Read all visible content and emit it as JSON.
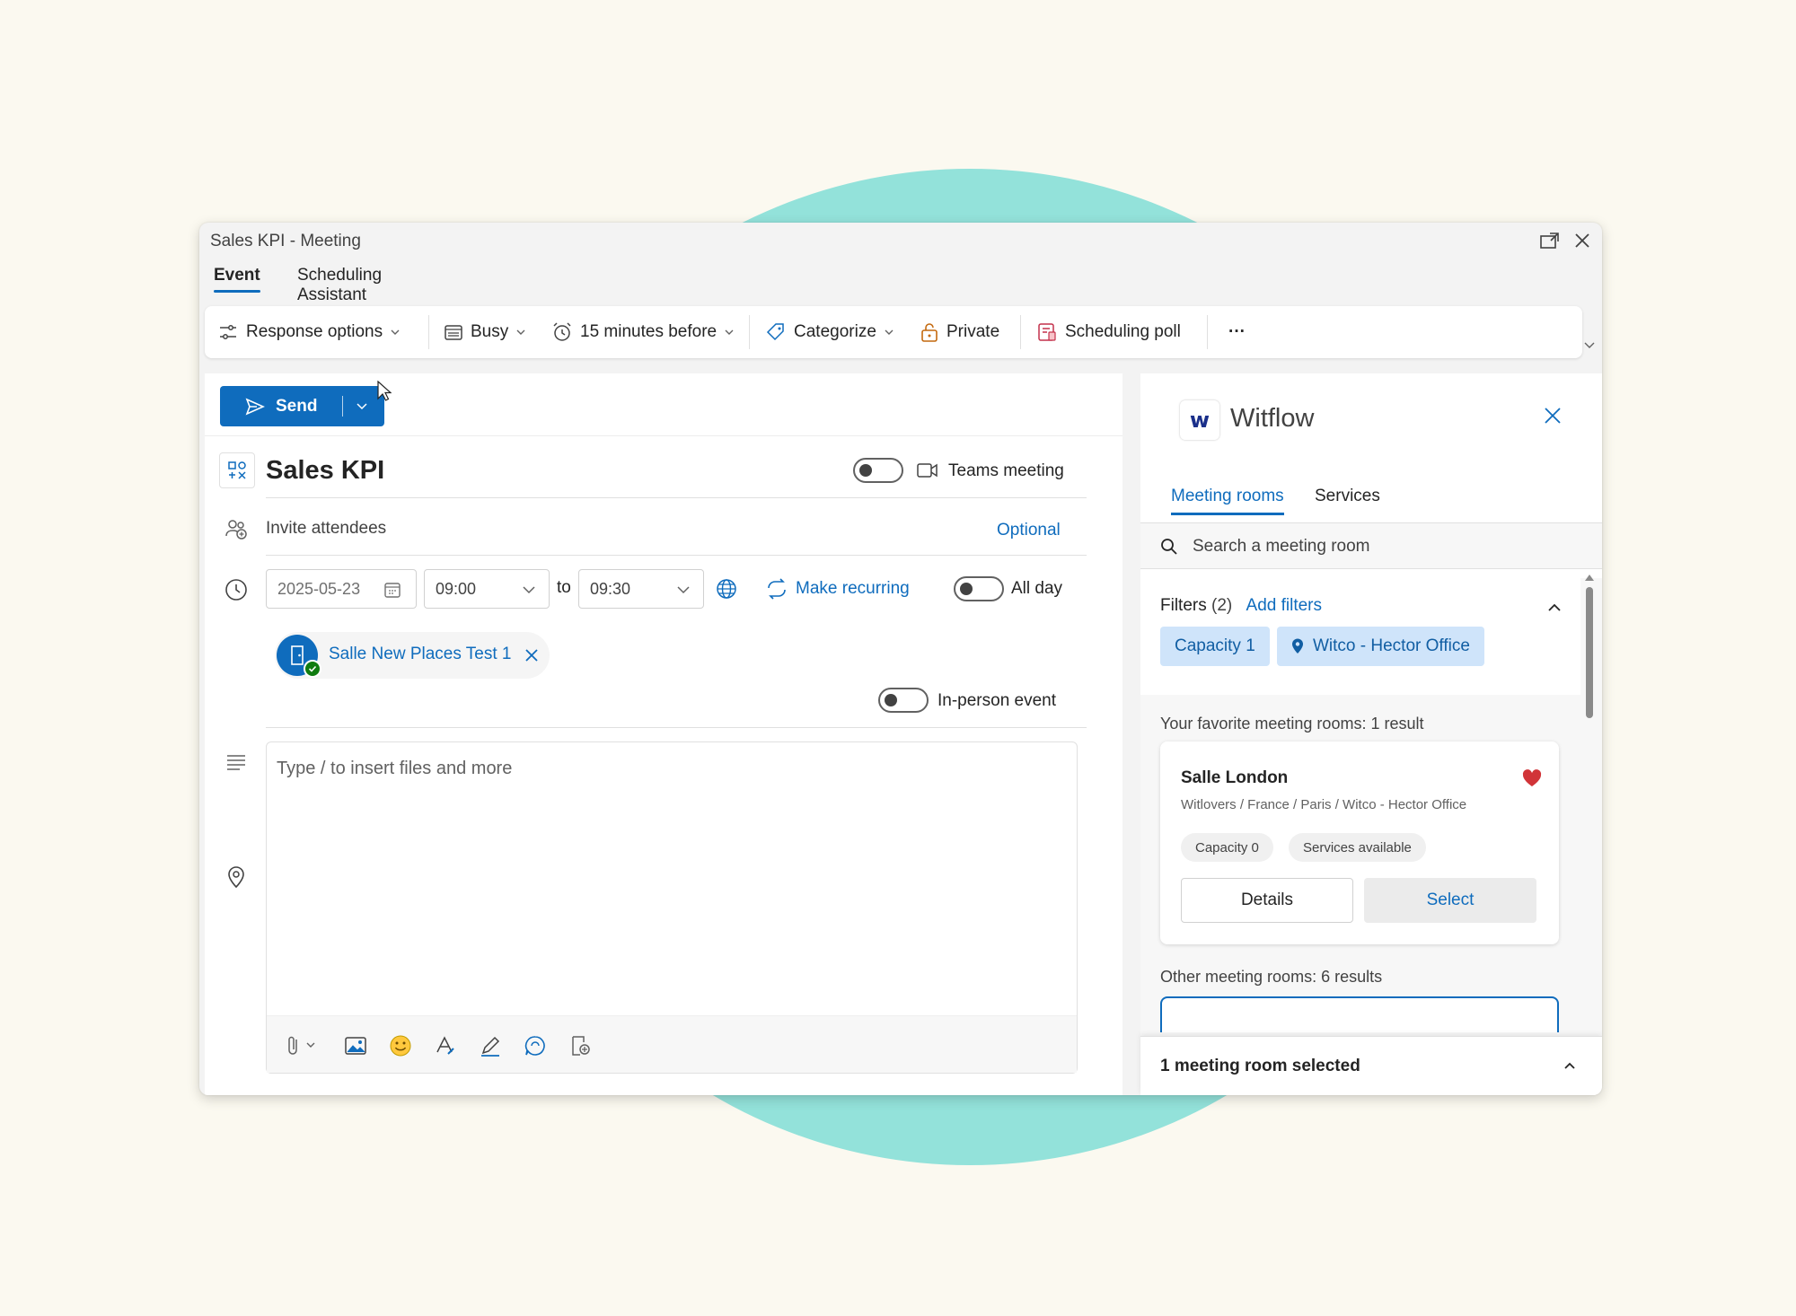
{
  "window": {
    "title": "Sales KPI - Meeting"
  },
  "tabs": [
    {
      "label": "Event"
    },
    {
      "label": "Scheduling Assistant"
    }
  ],
  "ribbon": {
    "response_options": "Response options",
    "busy": "Busy",
    "reminder": "15 minutes before",
    "categorize": "Categorize",
    "private": "Private",
    "scheduling_poll": "Scheduling poll",
    "more": "···"
  },
  "editor": {
    "send_label": "Send",
    "subject": "Sales KPI",
    "teams_meeting": "Teams meeting",
    "invite_placeholder": "Invite attendees",
    "optional": "Optional",
    "date": "2025-05-23",
    "start_time": "09:00",
    "to": "to",
    "end_time": "09:30",
    "make_recurring": "Make recurring",
    "all_day": "All day",
    "location_chip": "Salle New Places Test 1",
    "in_person": "In-person event",
    "body_placeholder": "Type / to insert files and more"
  },
  "panel": {
    "app_name": "Witflow",
    "logo_glyph": "w",
    "tabs": [
      {
        "label": "Meeting rooms"
      },
      {
        "label": "Services"
      }
    ],
    "search_placeholder": "Search a meeting room",
    "filters_label": "Filters",
    "filters_count": "(2)",
    "add_filters": "Add filters",
    "filter_pills": [
      {
        "label": "Capacity 1"
      },
      {
        "label": "Witco - Hector Office"
      }
    ],
    "favorites_label": "Your favorite meeting rooms: 1 result",
    "favorite_room": {
      "name": "Salle London",
      "path": "Witlovers / France / Paris / Witco - Hector Office",
      "tags": [
        "Capacity 0",
        "Services available"
      ],
      "details": "Details",
      "select": "Select"
    },
    "other_label": "Other meeting rooms: 6 results",
    "footer": "1 meeting room selected"
  },
  "colors": {
    "accent": "#0f6cbd",
    "background": "#fbf9f0",
    "circle": "#93e2da",
    "heart": "#d13438"
  }
}
